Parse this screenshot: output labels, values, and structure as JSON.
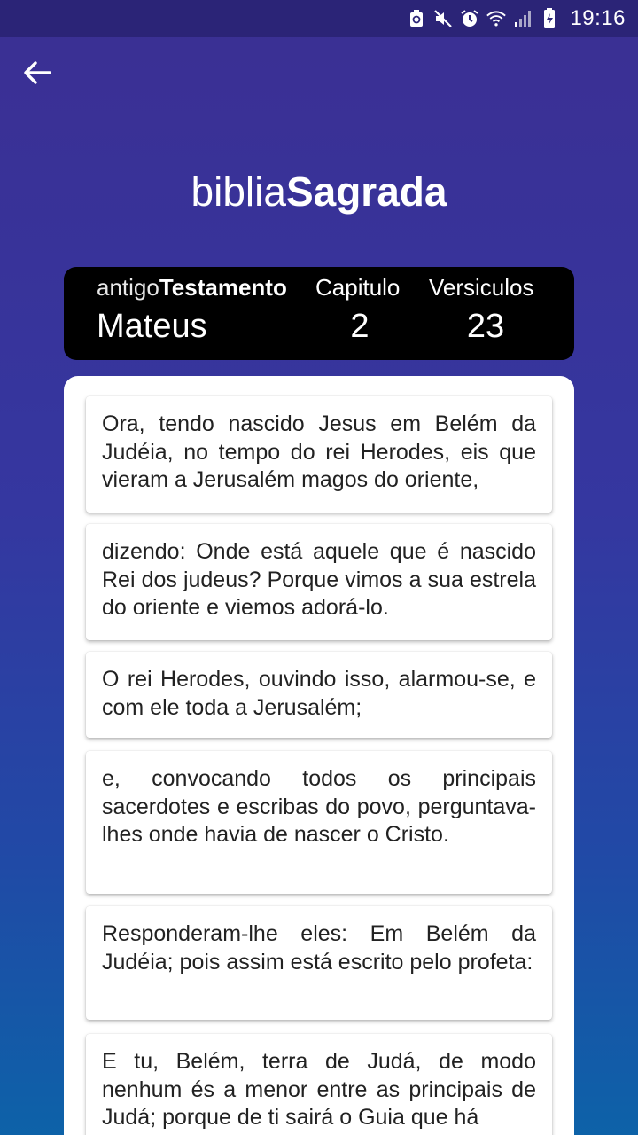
{
  "status_bar": {
    "time": "19:16",
    "icons": [
      "android-sync-icon",
      "mute-icon",
      "alarm-icon",
      "wifi-icon",
      "signal-icon",
      "battery-icon"
    ]
  },
  "header": {
    "back_icon": "arrow-left-icon",
    "brand_light": "biblia",
    "brand_bold": "Sagrada"
  },
  "info": {
    "testament_light": "antigo",
    "testament_bold": "Testamento",
    "book": "Mateus",
    "chapter_label": "Capitulo",
    "chapter": "2",
    "verses_label": "Versiculos",
    "verses": "23"
  },
  "verses": [
    "Ora, tendo nascido Jesus em Belém da Judéia, no tempo do rei Herodes, eis que vieram a Jerusalém magos do oriente,",
    "dizendo: Onde está aquele que é nascido Rei dos judeus? Porque vimos a sua estrela do oriente e viemos adorá-lo.",
    "O rei Herodes, ouvindo isso, alarmou-se, e com ele toda a Jerusalém;",
    "e, convocando todos os principais sacerdotes e escribas do povo, perguntava-lhes onde havia de nascer o Cristo.",
    "Responderam-lhe eles: Em Belém da Judéia; pois assim está escrito pelo profeta:",
    "E tu, Belém, terra de Judá, de modo nenhum és a menor entre as principais de Judá; porque de ti sairá o Guia que há"
  ],
  "colors": {
    "background_top": "#3b2f93",
    "background_bottom": "#0d62a8",
    "status_bar": "#2b2477",
    "info_bar": "#000000",
    "card": "#ffffff"
  }
}
